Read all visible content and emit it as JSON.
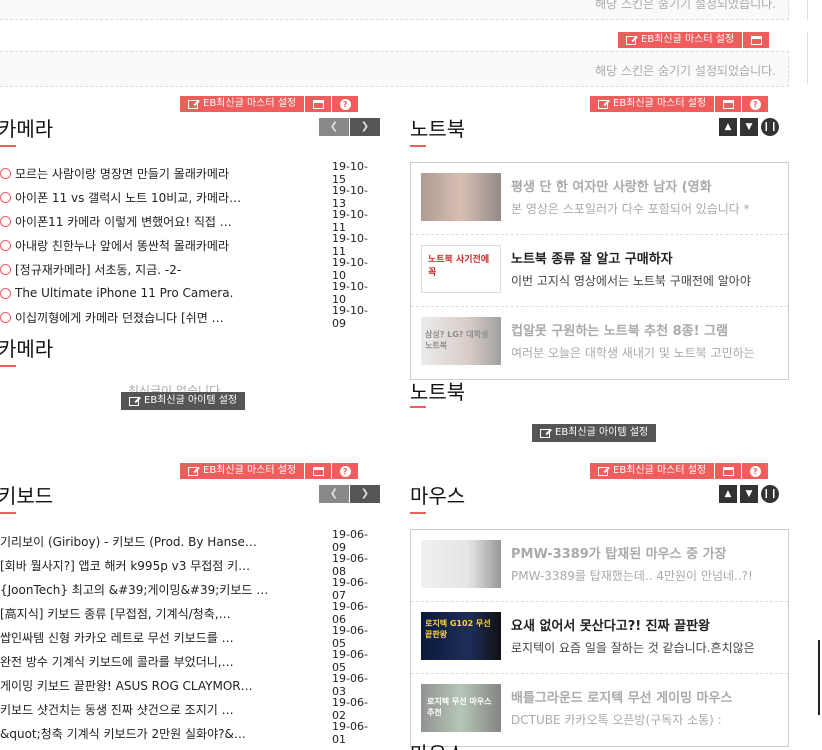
{
  "hidden_text": "해당 스킨은 숨기기 설정되었습니다.",
  "master_label": "EB최신글 마스터 설정",
  "item_label": "EB최신글 아이템 설정",
  "empty_text": "최신글이 없습니다.",
  "icons": {
    "edit": "edit-icon",
    "window": "window-icon",
    "help": "help-icon",
    "prev": "chevron-left-icon",
    "next": "chevron-right-icon",
    "up": "chevron-up-icon",
    "down": "chevron-down-icon",
    "pause": "pause-icon",
    "check": "check-circle-icon"
  },
  "colors": {
    "accent": "#ef5d5d",
    "nav": "#555555"
  },
  "camera": {
    "title": "카메라",
    "title2": "카메라",
    "posts": [
      {
        "title": "모르는 사람이랑 명장면 만들기 몰래카메라",
        "date": "19-10-15"
      },
      {
        "title": "아이폰 11 vs 갤럭시 노트 10비교, 카메라…",
        "date": "19-10-13"
      },
      {
        "title": "아이폰11 카메라 이렇게 변했어요! 직접 …",
        "date": "19-10-11"
      },
      {
        "title": "아내랑 친한누나 앞에서 똥싼척 몰래카메라",
        "date": "19-10-11"
      },
      {
        "title": "[정규재카메라] 서초동, 지금. -2-",
        "date": "19-10-10"
      },
      {
        "title": "The Ultimate iPhone 11 Pro Camera.",
        "date": "19-10-10"
      },
      {
        "title": "이십끼형에게 카메라 던졌습니다 [쉬면 …",
        "date": "19-10-09"
      }
    ]
  },
  "notebook": {
    "title": "노트북",
    "title2": "노트북",
    "videos": [
      {
        "title": "평생 단 한 여자만 사랑한 남자 (영화",
        "desc": "본 영상은 스포일러가 다수 포함되어 있습니다 *",
        "thumb_text": ""
      },
      {
        "title": "노트북 종류 잘 알고 구매하자",
        "desc": "이번 고지식 영상에서는 노트북 구매전에 알아야",
        "thumb_text": "노트북 사기전에 꼭"
      },
      {
        "title": "컵알못 구원하는 노트북 추천 8종! 그램",
        "desc": "여러분 오늘은 대학생 새내기 및 노트북 고민하는",
        "thumb_text": "삼성? LG? 대학생 노트북"
      }
    ]
  },
  "keyboard": {
    "title": "키보드",
    "posts": [
      {
        "title": "기리보이 (Giriboy) - 키보드 (Prod. By Hanse…",
        "date": "19-06-09"
      },
      {
        "title": "[회바 뭘사지?] 앱코 해커 k995p v3 무접점 키…",
        "date": "19-06-08"
      },
      {
        "title": "{JoonTech} 최고의 &#39;게이밍&#39;키보드 …",
        "date": "19-06-07"
      },
      {
        "title": "[高지식] 키보드 종류 [무접점, 기계식/청축,…",
        "date": "19-06-06"
      },
      {
        "title": "쌉인싸템 신형 카카오 레트로 무선 키보드를 …",
        "date": "19-06-05"
      },
      {
        "title": "완전 방수 기계식 키보드에 콜라를 부었더니,…",
        "date": "19-06-05"
      },
      {
        "title": "게이밍 키보드 끝판왕! ASUS ROG CLAYMOR…",
        "date": "19-06-03"
      },
      {
        "title": "키보드 샷건치는 동생 진짜 샷건으로 조지기 …",
        "date": "19-06-02"
      },
      {
        "title": "&quot;청축 기계식 키보드가 2만원 실화야?&…",
        "date": "19-06-01"
      }
    ]
  },
  "mouse": {
    "title": "마우스",
    "videos": [
      {
        "title": "PMW-3389가 탑재된 마우스 중 가장",
        "desc": "PMW-3389를 탑재했는데.. 4만원이 안넘네..?!",
        "thumb_text": ""
      },
      {
        "title": "요새 없어서 못산다고?! 진짜 끝판왕",
        "desc": "로지텍이 요즘 일을 잘하는 것 같습니다.흔치않은",
        "thumb_text": "로지텍 G102 무선 끝판왕"
      },
      {
        "title": "배틀그라운드 로지텍 무선 게이밍 마우스",
        "desc": "DCTUBE 카카오톡 오픈방(구독자 소통) :",
        "thumb_text": "로지텍 무선 마우스 추천"
      }
    ]
  },
  "cut_title": "마우스"
}
